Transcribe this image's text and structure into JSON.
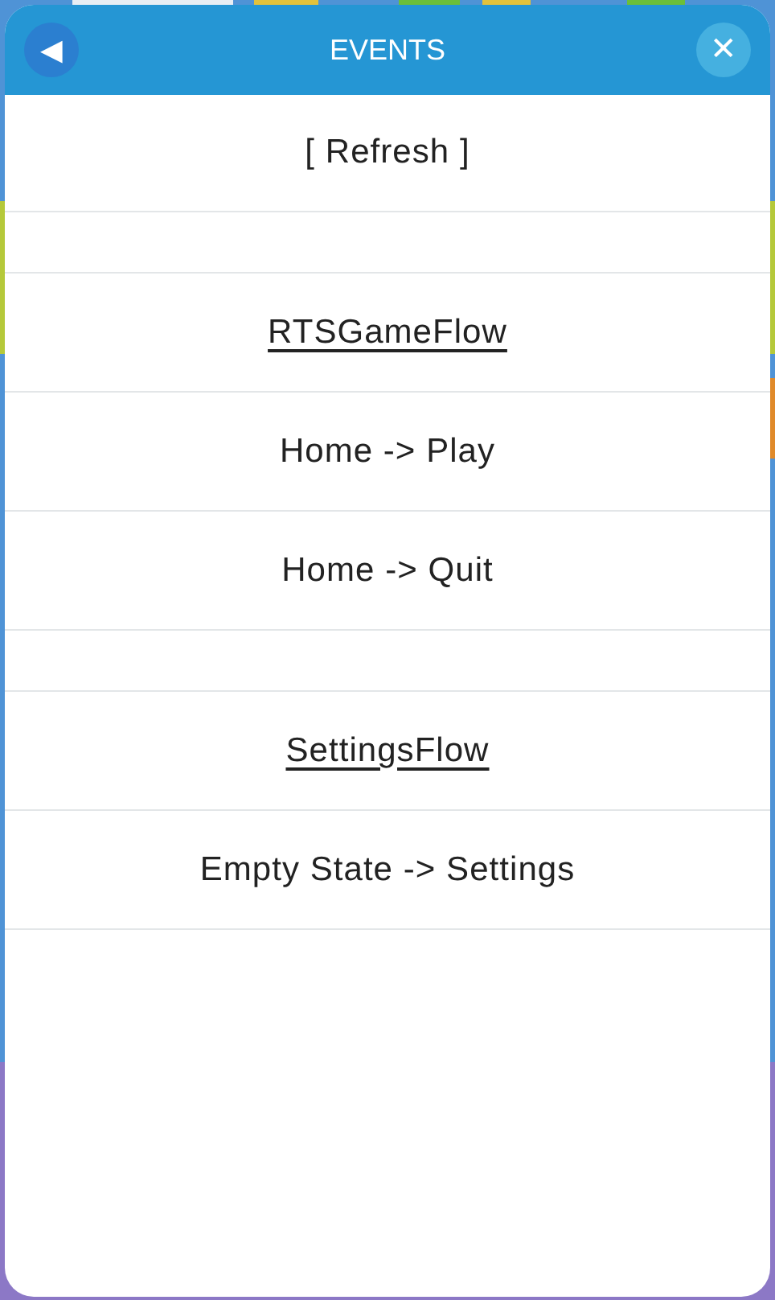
{
  "window": {
    "title": "EVENTS",
    "back": "◀",
    "close": "✕"
  },
  "items": [
    {
      "kind": "action",
      "label": "[ Refresh ]"
    },
    {
      "kind": "spacer"
    },
    {
      "kind": "group",
      "label": "RTSGameFlow"
    },
    {
      "kind": "event",
      "label": "Home -> Play"
    },
    {
      "kind": "event",
      "label": "Home -> Quit"
    },
    {
      "kind": "spacer"
    },
    {
      "kind": "group",
      "label": "SettingsFlow"
    },
    {
      "kind": "event",
      "label": "Empty State -> Settings"
    }
  ]
}
